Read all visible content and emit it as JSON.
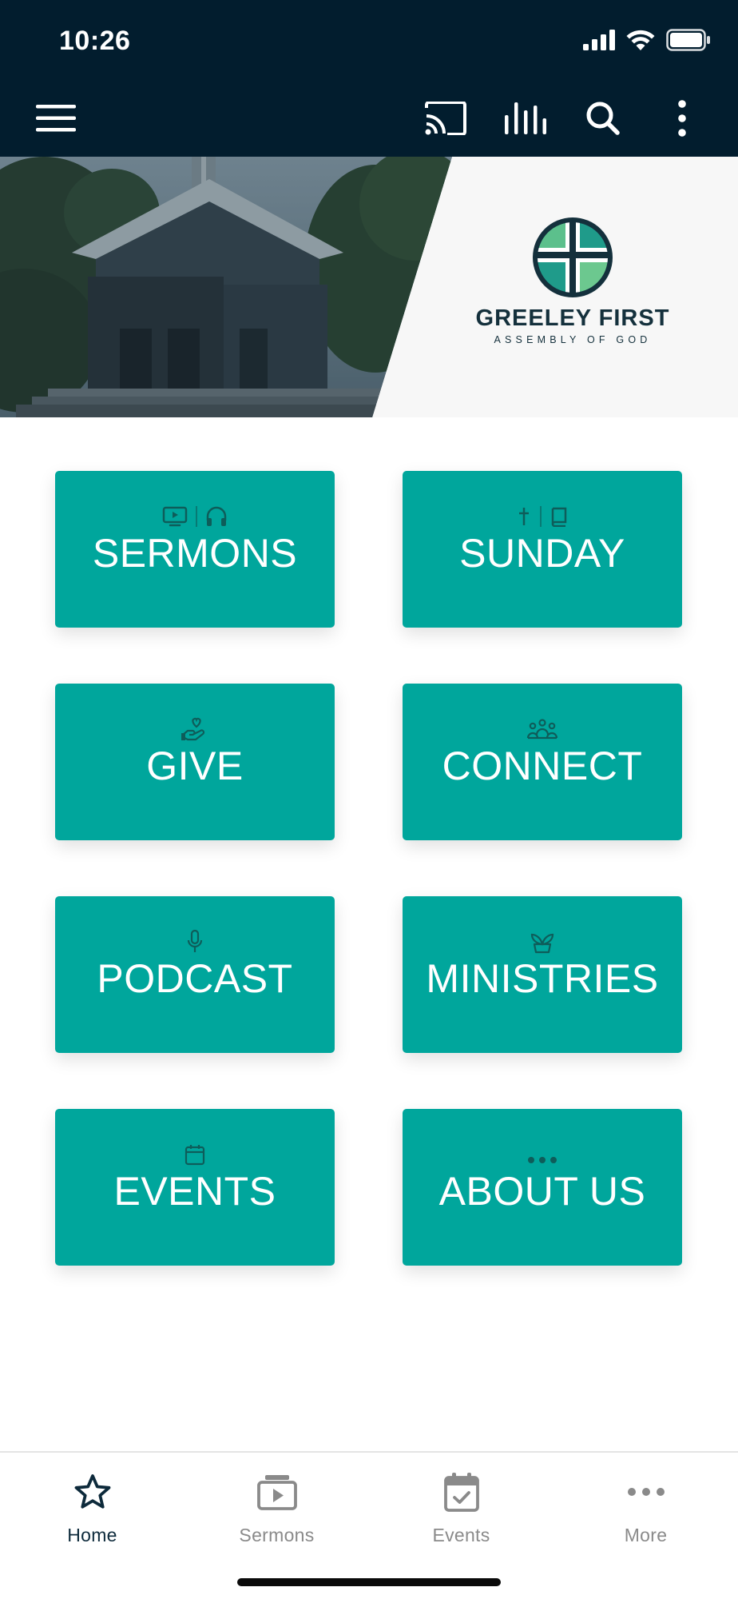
{
  "status_bar": {
    "time": "10:26"
  },
  "app_bar": {
    "icons": [
      "menu-icon",
      "cast-icon",
      "audio-bars-icon",
      "search-icon",
      "more-vertical-icon"
    ]
  },
  "hero": {
    "logo_title": "GREELEY FIRST",
    "logo_subtitle": "ASSEMBLY OF GOD"
  },
  "tiles": [
    {
      "label": "SERMONS",
      "icons": [
        "tv-icon",
        "headphones-icon"
      ]
    },
    {
      "label": "SUNDAY",
      "icons": [
        "cross-icon",
        "bible-icon"
      ]
    },
    {
      "label": "GIVE",
      "icons": [
        "heart-hand-icon"
      ]
    },
    {
      "label": "CONNECT",
      "icons": [
        "group-icon"
      ]
    },
    {
      "label": "PODCAST",
      "icons": [
        "microphone-icon"
      ]
    },
    {
      "label": "MINISTRIES",
      "icons": [
        "sprout-icon"
      ]
    },
    {
      "label": "EVENTS",
      "icons": [
        "calendar-icon"
      ]
    },
    {
      "label": "ABOUT US",
      "icons": [
        "dots-icon"
      ]
    }
  ],
  "bottom_nav": {
    "items": [
      {
        "label": "Home",
        "icon": "star-icon",
        "active": true
      },
      {
        "label": "Sermons",
        "icon": "video-library-icon",
        "active": false
      },
      {
        "label": "Events",
        "icon": "calendar-check-icon",
        "active": false
      },
      {
        "label": "More",
        "icon": "more-horizontal-icon",
        "active": false
      }
    ]
  },
  "colors": {
    "header_bg": "#021d2e",
    "tile_bg": "#00a69c",
    "tile_icon": "#0e5d5a",
    "nav_active": "#0d2a3b",
    "nav_inactive": "#8a8a8a"
  }
}
